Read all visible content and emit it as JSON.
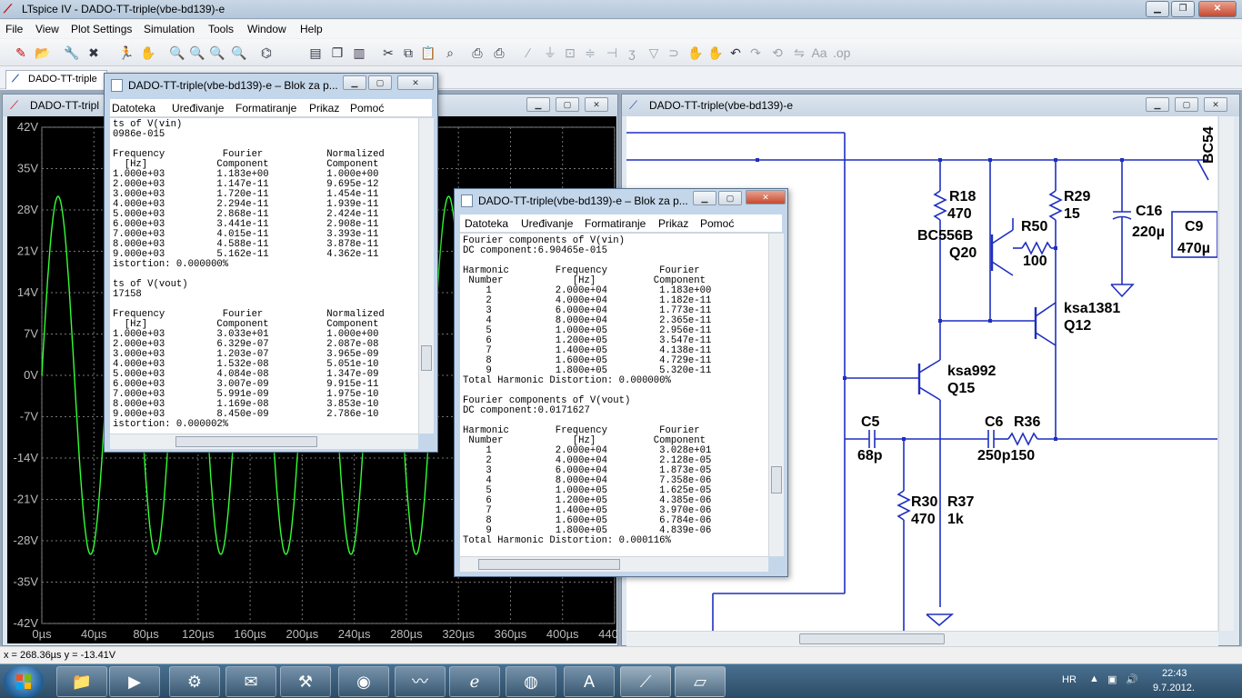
{
  "app": {
    "title": "LTspice IV - DADO-TT-triple(vbe-bd139)-e",
    "menu": [
      "File",
      "View",
      "Plot Settings",
      "Simulation",
      "Tools",
      "Window",
      "Help"
    ],
    "tab_label": "DADO-TT-triple"
  },
  "plot_window": {
    "title": "DADO-TT-tripl",
    "y_ticks": [
      "42V",
      "35V",
      "28V",
      "21V",
      "14V",
      "7V",
      "0V",
      "-7V",
      "-14V",
      "-21V",
      "-28V",
      "-35V",
      "-42V"
    ],
    "x_ticks": [
      "0µs",
      "40µs",
      "80µs",
      "120µs",
      "160µs",
      "200µs",
      "240µs",
      "280µs",
      "320µs",
      "360µs",
      "400µs",
      "440µs"
    ],
    "trace_color": "#33ff33",
    "background": "#000000"
  },
  "chart_data": {
    "type": "line",
    "series": [
      {
        "amplitude": 30.3,
        "period_us": 50
      }
    ],
    "xlim": [
      0,
      440
    ],
    "ylim": [
      -42,
      42
    ],
    "x_unit": "µs",
    "y_unit": "V",
    "grid": true
  },
  "schematic_window": {
    "title": "DADO-TT-triple(vbe-bd139)-e",
    "labels": [
      {
        "id": "bc54",
        "text": "BC54"
      },
      {
        "id": "r18",
        "text": "R18"
      },
      {
        "id": "r18v",
        "text": "470"
      },
      {
        "id": "r29",
        "text": "R29"
      },
      {
        "id": "r29v",
        "text": "15"
      },
      {
        "id": "c16",
        "text": "C16"
      },
      {
        "id": "c16v",
        "text": "220µ"
      },
      {
        "id": "c9",
        "text": "C9"
      },
      {
        "id": "c9v",
        "text": "470µ"
      },
      {
        "id": "bc556",
        "text": "BC556B"
      },
      {
        "id": "q20",
        "text": "Q20"
      },
      {
        "id": "r50",
        "text": "R50"
      },
      {
        "id": "r50v",
        "text": "100"
      },
      {
        "id": "ksa1381",
        "text": "ksa1381"
      },
      {
        "id": "q12",
        "text": "Q12"
      },
      {
        "id": "ksa992",
        "text": "ksa992"
      },
      {
        "id": "q15",
        "text": "Q15"
      },
      {
        "id": "c5",
        "text": "C5"
      },
      {
        "id": "c5v",
        "text": "68p"
      },
      {
        "id": "c6",
        "text": "C6"
      },
      {
        "id": "r36",
        "text": "R36"
      },
      {
        "id": "c6v",
        "text": "250p150"
      },
      {
        "id": "r30",
        "text": "R30"
      },
      {
        "id": "r30v",
        "text": "470"
      },
      {
        "id": "r37",
        "text": "R37"
      },
      {
        "id": "r37v",
        "text": "1k"
      }
    ]
  },
  "notepad1": {
    "title": "DADO-TT-triple(vbe-bd139)-e – Blok za p...",
    "menu": [
      "Datoteka",
      "Uređivanje",
      "Formatiranje",
      "Prikaz",
      "Pomoć"
    ],
    "content": "ts of V(vin)\n0986e-015\n\nFrequency          Fourier           Normalized\n  [Hz]            Component          Component\n1.000e+03         1.183e+00          1.000e+00\n2.000e+03         1.147e-11          9.695e-12\n3.000e+03         1.720e-11          1.454e-11\n4.000e+03         2.294e-11          1.939e-11\n5.000e+03         2.868e-11          2.424e-11\n6.000e+03         3.441e-11          2.908e-11\n7.000e+03         4.015e-11          3.393e-11\n8.000e+03         4.588e-11          3.878e-11\n9.000e+03         5.162e-11          4.362e-11\nistortion: 0.000000%\n\nts of V(vout)\n17158\n\nFrequency          Fourier           Normalized\n  [Hz]            Component          Component\n1.000e+03         3.033e+01          1.000e+00\n2.000e+03         6.329e-07          2.087e-08\n3.000e+03         1.203e-07          3.965e-09\n4.000e+03         1.532e-08          5.051e-10\n5.000e+03         4.084e-08          1.347e-09\n6.000e+03         3.007e-09          9.915e-11\n7.000e+03         5.991e-09          1.975e-10\n8.000e+03         1.169e-08          3.853e-10\n9.000e+03         8.450e-09          2.786e-10\nistortion: 0.000002%"
  },
  "notepad2": {
    "title": "DADO-TT-triple(vbe-bd139)-e – Blok za p...",
    "menu": [
      "Datoteka",
      "Uređivanje",
      "Formatiranje",
      "Prikaz",
      "Pomoć"
    ],
    "content": "Fourier components of V(vin)\nDC component:6.90465e-015\n\nHarmonic        Frequency         Fourier\n Number            [Hz]          Component\n    1           2.000e+04         1.183e+00\n    2           4.000e+04         1.182e-11\n    3           6.000e+04         1.773e-11\n    4           8.000e+04         2.365e-11\n    5           1.000e+05         2.956e-11\n    6           1.200e+05         3.547e-11\n    7           1.400e+05         4.138e-11\n    8           1.600e+05         4.729e-11\n    9           1.800e+05         5.320e-11\nTotal Harmonic Distortion: 0.000000%\n\nFourier components of V(vout)\nDC component:0.0171627\n\nHarmonic        Frequency         Fourier\n Number            [Hz]          Component\n    1           2.000e+04         3.028e+01\n    2           4.000e+04         2.128e-05\n    3           6.000e+04         1.873e-05\n    4           8.000e+04         7.358e-06\n    5           1.000e+05         1.625e-05\n    6           1.200e+05         4.385e-06\n    7           1.400e+05         3.970e-06\n    8           1.600e+05         6.784e-06\n    9           1.800e+05         4.839e-06\nTotal Harmonic Distortion: 0.000116%"
  },
  "status": {
    "text": "x = 268.36µs   y = -13.41V"
  },
  "taskbar": {
    "lang": "HR",
    "time": "22:43",
    "date": "9.7.2012."
  }
}
